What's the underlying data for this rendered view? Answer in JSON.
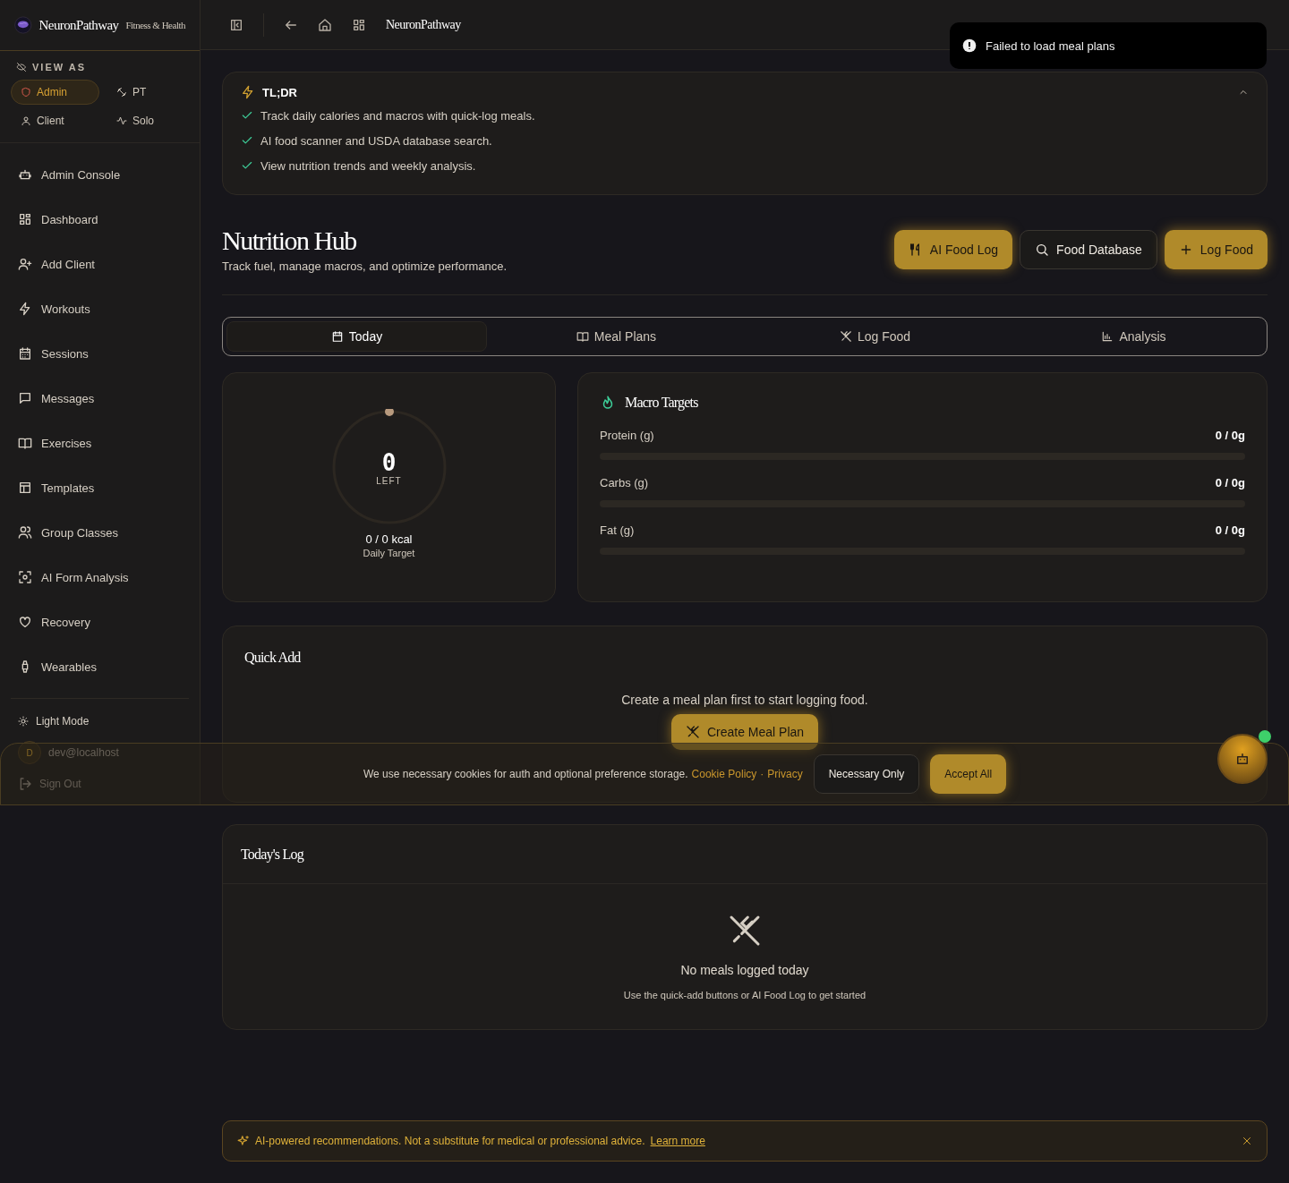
{
  "sidebar": {
    "brand": "NeuronPathway",
    "tagline": "Fitness & Health",
    "view_as_label": "VIEW AS",
    "roles": [
      {
        "label": "Admin",
        "selected": true
      },
      {
        "label": "PT",
        "selected": false
      },
      {
        "label": "Client",
        "selected": false
      },
      {
        "label": "Solo",
        "selected": false
      }
    ],
    "nav_items": [
      "Admin Console",
      "Dashboard",
      "Add Client",
      "Workouts",
      "Sessions",
      "Messages",
      "Exercises",
      "Templates",
      "Group Classes",
      "AI Form Analysis",
      "Recovery",
      "Wearables"
    ],
    "theme_toggle": "Light Mode",
    "user": {
      "initial": "D",
      "email": "dev@localhost"
    },
    "sign_out": "Sign Out"
  },
  "topbar": {
    "title": "NeuronPathway"
  },
  "toast": {
    "message": "Failed to load meal plans"
  },
  "tldr": {
    "title": "TL;DR",
    "expanded": true,
    "points": [
      "Track daily calories and macros with quick-log meals.",
      "AI food scanner and USDA database search.",
      "View nutrition trends and weekly analysis."
    ]
  },
  "header": {
    "title": "Nutrition Hub",
    "subtitle": "Track fuel, manage macros, and optimize performance.",
    "actions": [
      {
        "label": "AI Food Log",
        "kind": "primary"
      },
      {
        "label": "Food Database",
        "kind": "outline"
      },
      {
        "label": "Log Food",
        "kind": "primary"
      }
    ]
  },
  "tabs": [
    {
      "label": "Today",
      "selected": true
    },
    {
      "label": "Meal Plans",
      "selected": false
    },
    {
      "label": "Log Food",
      "selected": false
    },
    {
      "label": "Analysis",
      "selected": false
    }
  ],
  "calories": {
    "remaining": "0",
    "remaining_label": "LEFT",
    "reading": "0 / 0 kcal",
    "caption": "Daily Target"
  },
  "macros": {
    "title": "Macro Targets",
    "rows": [
      {
        "label": "Protein (g)",
        "reading": "0 / 0g",
        "level": 0
      },
      {
        "label": "Carbs (g)",
        "reading": "0 / 0g",
        "level": 0
      },
      {
        "label": "Fat (g)",
        "reading": "0 / 0g",
        "level": 0
      }
    ]
  },
  "quick_add": {
    "title": "Quick Add",
    "message": "Create a meal plan first to start logging food.",
    "button": "Create Meal Plan"
  },
  "todays_log": {
    "title": "Today's Log",
    "empty_title": "No meals logged today",
    "empty_hint": "Use the quick-add buttons or AI Food Log to get started"
  },
  "cookie_banner": {
    "text": "We use necessary cookies for auth and optional preference storage.",
    "links": [
      "Cookie Policy",
      "Privacy"
    ],
    "separator": "·",
    "buttons": [
      {
        "label": "Necessary Only",
        "kind": "outline"
      },
      {
        "label": "Accept All",
        "kind": "primary"
      }
    ]
  },
  "disclaimer": {
    "text": "AI-powered recommendations. Not a substitute for medical or professional advice.",
    "link": "Learn more"
  },
  "chat_button": {
    "online": true
  }
}
